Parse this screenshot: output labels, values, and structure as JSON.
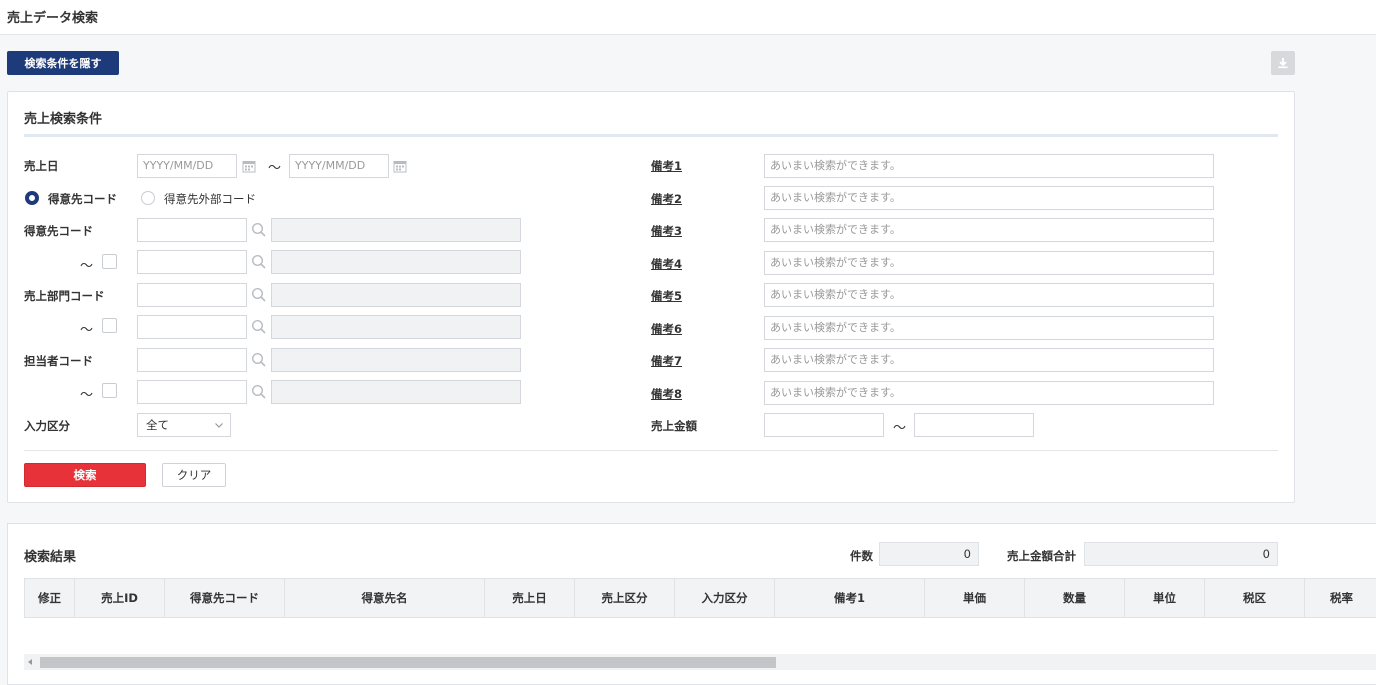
{
  "header": {
    "title": "売上データ検索"
  },
  "toolbar": {
    "toggle_label": "検索条件を隠す"
  },
  "conditions": {
    "title": "売上検索条件",
    "sales_date": {
      "label": "売上日",
      "from_placeholder": "YYYY/MM/DD",
      "to_placeholder": "YYYY/MM/DD",
      "tilde": "～"
    },
    "radio": {
      "option1": "得意先コード",
      "option2": "得意先外部コード",
      "selected": "得意先コード"
    },
    "customer_code": {
      "label": "得意先コード"
    },
    "dept_code": {
      "label": "売上部門コード"
    },
    "staff_code": {
      "label": "担当者コード"
    },
    "range_tilde": "～",
    "input_category": {
      "label": "入力区分",
      "value": "全て"
    },
    "remarks": {
      "labels": [
        "備考1",
        "備考2",
        "備考3",
        "備考4",
        "備考5",
        "備考6",
        "備考7",
        "備考8"
      ],
      "placeholder": "あいまい検索ができます。"
    },
    "amount": {
      "label": "売上金額",
      "tilde": "～"
    },
    "search_label": "検索",
    "clear_label": "クリア"
  },
  "results": {
    "title": "検索結果",
    "count_label": "件数",
    "count_value": "0",
    "total_label": "売上金額合計",
    "total_value": "0",
    "columns": [
      "修正",
      "売上ID",
      "得意先コード",
      "得意先名",
      "売上日",
      "売上区分",
      "入力区分",
      "備考1",
      "単価",
      "数量",
      "単位",
      "税区",
      "税率"
    ]
  },
  "colors": {
    "primary": "#1d3a7a",
    "danger": "#e8323a"
  }
}
